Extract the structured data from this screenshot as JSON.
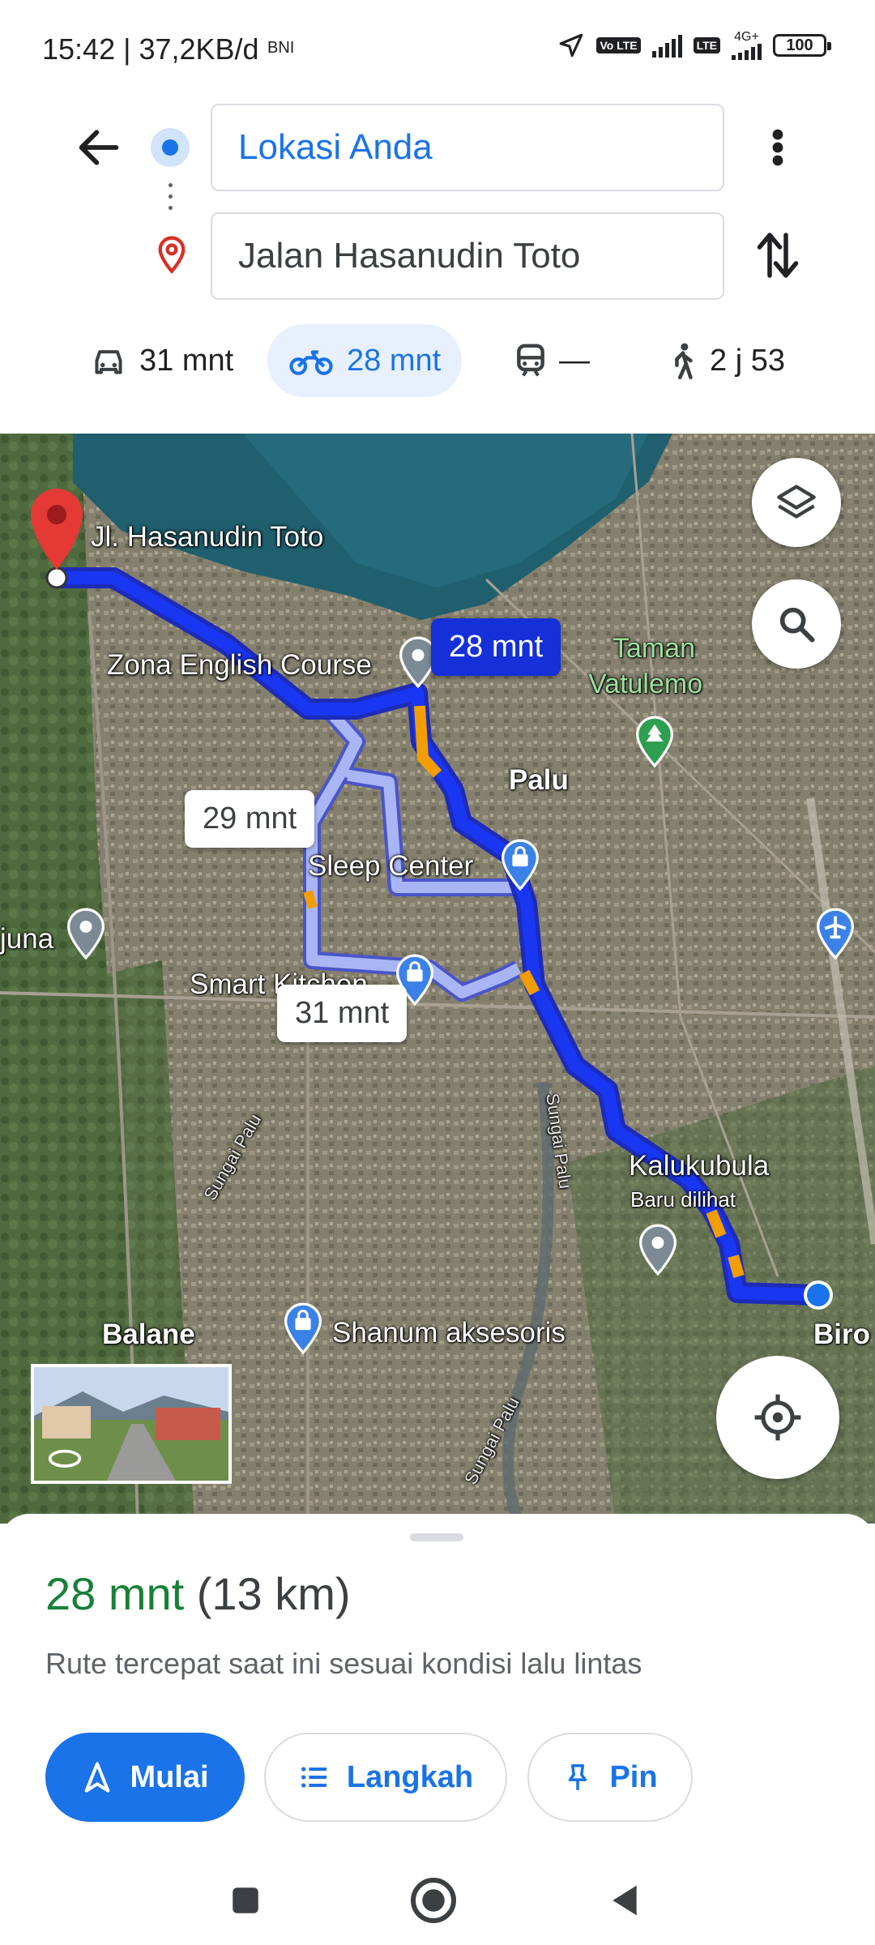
{
  "status": {
    "time_speed": "15:42 | 37,2KB/d",
    "carrier": "BNI",
    "volte": "Vo LTE",
    "network": "4G+",
    "battery": "100"
  },
  "search": {
    "origin": "Lokasi Anda",
    "destination": "Jalan Hasanudin Toto"
  },
  "modes": [
    {
      "icon": "car-icon",
      "label": "31 mnt"
    },
    {
      "icon": "motorcycle-icon",
      "label": "28 mnt"
    },
    {
      "icon": "train-icon",
      "label": "—"
    },
    {
      "icon": "walk-icon",
      "label": "2 j 53"
    }
  ],
  "map": {
    "labels": {
      "dest_pin": "Jl. Hasanudin Toto",
      "zona": "Zona English Course",
      "taman": "Taman Vatulemo",
      "palu": "Palu",
      "sleep": "Sleep Center",
      "juna": "juna",
      "smart": "Smart Kitchen",
      "kalukubula": "Kalukubula",
      "baru": "Baru dilihat",
      "balane": "Balane",
      "shanum": "Shanum aksesoris",
      "biro": "Biro",
      "sungai1": "Sungai Palu",
      "sungai2": "Sungai Palu",
      "sungai3": "Sungai Palu"
    },
    "chips": {
      "selected": "28 mnt",
      "alt1": "29 mnt",
      "alt2": "31 mnt"
    }
  },
  "sheet": {
    "duration": "28 mnt",
    "distance": "(13 km)",
    "subtitle": "Rute tercepat saat ini sesuai kondisi lalu lintas",
    "start": "Mulai",
    "steps": "Langkah",
    "pin": "Pin"
  }
}
